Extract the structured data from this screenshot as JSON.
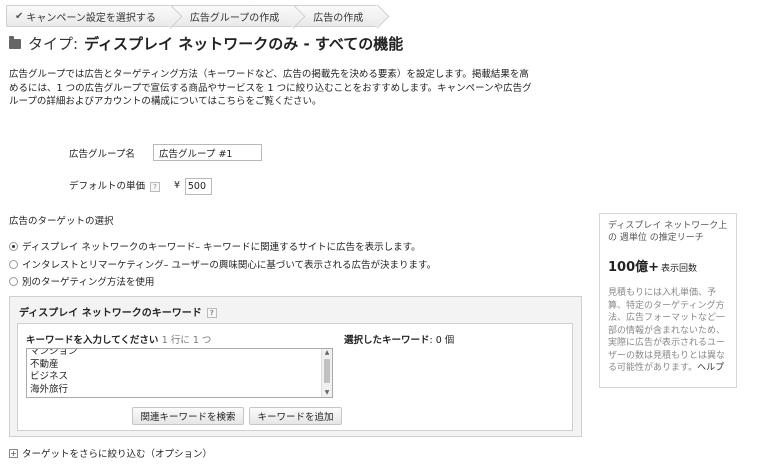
{
  "breadcrumb": {
    "step1": "キャンペーン設定を選択する",
    "step2": "広告グループの作成",
    "step3": "広告の作成"
  },
  "title": {
    "prefix": "タイプ:",
    "main": "ディスプレイ ネットワークのみ - すべての機能"
  },
  "intro": {
    "text": "広告グループでは広告とターゲティング方法（キーワードなど、広告の掲載先を決める要素）を設定します。掲載結果を高めるには、1 つの広告グループで宣伝する商品やサービスを 1 つに絞り込むことをおすすめします。キャンペーンや広告グループの詳細およびアカウントの構成についてはこちらをご覧ください。"
  },
  "form": {
    "ad_group_name_label": "広告グループ名",
    "ad_group_name_value": "広告グループ #1",
    "default_bid_label": "デフォルトの単価",
    "help_mark": "?",
    "currency": "¥",
    "default_bid_value": "500"
  },
  "targeting": {
    "section_label": "広告のターゲットの選択",
    "options": [
      {
        "label": "ディスプレイ ネットワークのキーワード– キーワードに関連するサイトに広告を表示します。",
        "selected": true
      },
      {
        "label": "インタレストとリマーケティング– ユーザーの興味関心に基づいて表示される広告が決まります。",
        "selected": false
      },
      {
        "label": "別のターゲティング方法を使用",
        "selected": false
      }
    ]
  },
  "keywords": {
    "panel_title": "ディスプレイ ネットワークのキーワード",
    "input_title": "キーワードを入力してください",
    "input_hint": "1 行に 1 つ",
    "selected_title": "選択したキーワード",
    "selected_count": ": 0 個",
    "lines": [
      "マンション",
      "不動産",
      "ビジネス",
      "海外旅行"
    ],
    "search_button": "関連キーワードを検索",
    "add_button": "キーワードを追加"
  },
  "estimate": {
    "title": "ディスプレイ ネットワーク上の 週単位 の推定リーチ",
    "value": "100億+",
    "unit": "表示回数",
    "note": "見積もりには入札単価、予算、特定のターゲティング方法、広告フォーマットなど一部の情報が含まれないため、実際に広告が表示されるユーザーの数は見積もりとは異なる可能性があります。",
    "help": "ヘルプ"
  },
  "narrow": {
    "icon_glyph": "+",
    "label": "ターゲットをさらに絞り込む（オプション）"
  }
}
